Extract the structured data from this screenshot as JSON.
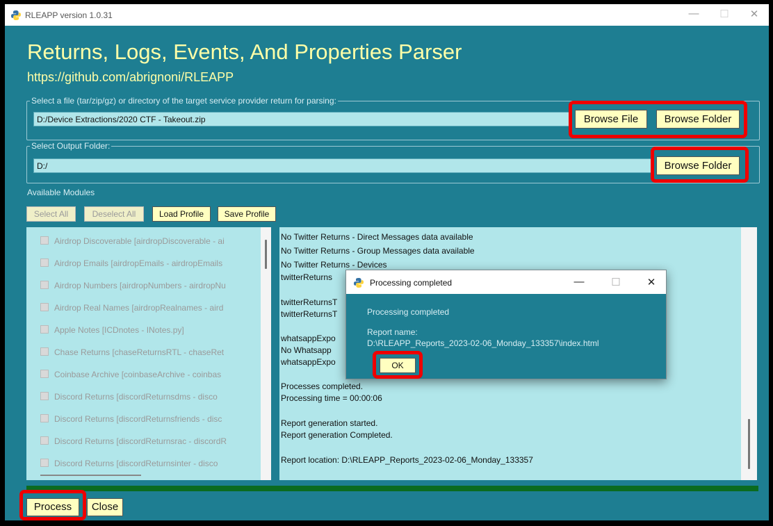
{
  "window": {
    "title": "RLEAPP version 1.0.31",
    "controls": {
      "minimize": "—",
      "maximize": "☐",
      "close": "✕"
    }
  },
  "header": {
    "title": "Returns, Logs, Events, And Properties Parser",
    "url": "https://github.com/abrignoni/RLEAPP"
  },
  "input_section": {
    "legend": "Select a file (tar/zip/gz) or directory of the target service provider return for parsing:",
    "value": "D:/Device Extractions/2020 CTF - Takeout.zip",
    "browse_file": "Browse File",
    "browse_folder": "Browse Folder"
  },
  "output_section": {
    "legend": "Select Output Folder:",
    "value": "D:/",
    "browse_folder": "Browse Folder"
  },
  "modules": {
    "label": "Available Modules",
    "select_all": "Select All",
    "deselect_all": "Deselect All",
    "load_profile": "Load Profile",
    "save_profile": "Save Profile",
    "items": [
      "Airdrop Discoverable [airdropDiscoverable - ai",
      "Airdrop Emails [airdropEmails - airdropEmails",
      "Airdrop Numbers [airdropNumbers - airdropNu",
      "Airdrop Real Names [airdropRealnames - aird",
      "Apple Notes [ICDnotes - INotes.py]",
      "Chase Returns [chaseReturnsRTL - chaseRet",
      "Coinbase Archive [coinbaseArchive - coinbas",
      "Discord Returns [discordReturnsdms - disco",
      "Discord Returns [discordReturnsfriends - disc",
      "Discord Returns [discordReturnsrac - discordR",
      "Discord Returns [discordReturnsinter - disco"
    ]
  },
  "log": {
    "lines": [
      "No Twitter Returns - Direct Messages data available",
      "No Twitter Returns - Group Messages data available",
      "No Twitter Returns - Devices",
      "twitterReturns",
      "twitterReturnsT",
      "twitterReturnsT",
      "whatsappExpo",
      "No Whatsapp",
      "whatsappExpo",
      "Processes completed.",
      "Processing time = 00:00:06",
      "Report generation started.",
      "Report generation Completed.",
      "Report location: D:\\RLEAPP_Reports_2023-02-06_Monday_133357"
    ]
  },
  "progress": {
    "value": 1.0
  },
  "dialog": {
    "title": "Processing completed",
    "message": "Processing completed",
    "report_label": "Report name:",
    "report_path": "D:\\RLEAPP_Reports_2023-02-06_Monday_133357\\index.html",
    "ok": "OK",
    "controls": {
      "minimize": "—",
      "maximize": "☐",
      "close": "✕"
    }
  },
  "footer": {
    "process": "Process",
    "close": "Close"
  },
  "colors": {
    "background": "#1e7e92",
    "field": "#b1e6ea",
    "button": "#ffffc0",
    "highlight": "#ee0000",
    "progress": "#0b6b1f"
  }
}
